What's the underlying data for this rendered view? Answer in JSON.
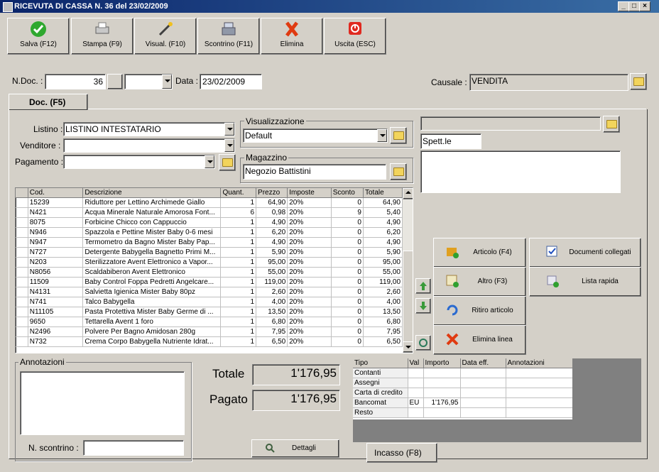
{
  "window": {
    "title": "RICEVUTA DI CASSA N. 36  del 23/02/2009"
  },
  "toolbar": [
    {
      "label": "Salva (F12)",
      "icon": "check-icon"
    },
    {
      "label": "Stampa (F9)",
      "icon": "printer-icon"
    },
    {
      "label": "Visual. (F10)",
      "icon": "magic-wand-icon"
    },
    {
      "label": "Scontrino (F11)",
      "icon": "cash-register-icon"
    },
    {
      "label": "Elimina",
      "icon": "delete-x-icon"
    },
    {
      "label": "Uscita (ESC)",
      "icon": "power-icon"
    }
  ],
  "header": {
    "ndoc_label": "N.Doc. :",
    "ndoc_value": "36",
    "series_value": "",
    "data_label": "Data :",
    "data_value": "23/02/2009",
    "causale_label": "Causale :",
    "causale_value": "VENDITA"
  },
  "tab": {
    "label": "Doc. (F5)"
  },
  "form": {
    "listino_label": "Listino :",
    "listino_value": "LISTINO INTESTATARIO",
    "venditore_label": "Venditore :",
    "venditore_value": "",
    "pagamento_label": "Pagamento :",
    "pagamento_value": "",
    "visualizzazione_title": "Visualizzazione",
    "visualizzazione_value": "Default",
    "magazzino_title": "Magazzino",
    "magazzino_value": "Negozio Battistini",
    "cliente_value": "",
    "spett_value": "Spett.le",
    "address_value": ""
  },
  "grid": {
    "columns": [
      "Cod.",
      "Descrizione",
      "Quant.",
      "Prezzo",
      "Imposte",
      "Sconto",
      "Totale"
    ],
    "rows": [
      [
        "15239",
        "Riduttore per Lettino Archimede Giallo",
        "1",
        "64,90",
        "20%",
        "0",
        "64,90"
      ],
      [
        "N421",
        "Acqua Minerale Naturale Amorosa Font...",
        "6",
        "0,98",
        "20%",
        "9",
        "5,40"
      ],
      [
        "8075",
        "Forbicine Chicco con Cappuccio",
        "1",
        "4,90",
        "20%",
        "0",
        "4,90"
      ],
      [
        "N946",
        "Spazzola e Pettine Mister Baby 0-6 mesi",
        "1",
        "6,20",
        "20%",
        "0",
        "6,20"
      ],
      [
        "N947",
        "Termometro da Bagno Mister Baby Pap...",
        "1",
        "4,90",
        "20%",
        "0",
        "4,90"
      ],
      [
        "N727",
        "Detergente Babygella Bagnetto Primi M...",
        "1",
        "5,90",
        "20%",
        "0",
        "5,90"
      ],
      [
        "N203",
        "Sterilizzatore Avent Elettronico a Vapor...",
        "1",
        "95,00",
        "20%",
        "0",
        "95,00"
      ],
      [
        "N8056",
        "Scaldabiberon Avent Elettronico",
        "1",
        "55,00",
        "20%",
        "0",
        "55,00"
      ],
      [
        "11509",
        "Baby Control Foppa Pedretti Angelcare...",
        "1",
        "119,00",
        "20%",
        "0",
        "119,00"
      ],
      [
        "N4131",
        "Salvietta Igienica Mister Baby 80pz",
        "1",
        "2,60",
        "20%",
        "0",
        "2,60"
      ],
      [
        "N741",
        "Talco Babygella",
        "1",
        "4,00",
        "20%",
        "0",
        "4,00"
      ],
      [
        "N11105",
        "Pasta Protettiva Mister Baby Germe di ...",
        "1",
        "13,50",
        "20%",
        "0",
        "13,50"
      ],
      [
        "9650",
        "Tettarella Avent 1 foro",
        "1",
        "6,80",
        "20%",
        "0",
        "6,80"
      ],
      [
        "N2496",
        "Polvere Per Bagno Amidosan 280g",
        "1",
        "7,95",
        "20%",
        "0",
        "7,95"
      ],
      [
        "N732",
        "Crema Corpo Babygella Nutriente Idrat...",
        "1",
        "6,50",
        "20%",
        "0",
        "6,50"
      ]
    ]
  },
  "actions": {
    "articolo": "Articolo (F4)",
    "altro": "Altro (F3)",
    "ritiro": "Ritiro articolo",
    "elimina_linea": "Elimina linea",
    "documenti": "Documenti collegati",
    "lista": "Lista rapida"
  },
  "annotazioni": {
    "title": "Annotazioni",
    "scontrino_label": "N. scontrino :",
    "scontrino_value": ""
  },
  "totals": {
    "totale_label": "Totale",
    "totale_value": "1'176,95",
    "pagato_label": "Pagato",
    "pagato_value": "1'176,95",
    "dettagli": "Dettagli"
  },
  "payments": {
    "columns": [
      "Tipo",
      "Val",
      "Importo",
      "Data eff.",
      "Annotazioni"
    ],
    "rows": [
      [
        "Contanti",
        "",
        "",
        "",
        ""
      ],
      [
        "Assegni",
        "",
        "",
        "",
        ""
      ],
      [
        "Carta di credito",
        "",
        "",
        "",
        ""
      ],
      [
        "Bancomat",
        "EU",
        "1'176,95",
        "",
        ""
      ],
      [
        "Resto",
        "",
        "",
        "",
        ""
      ]
    ]
  },
  "incasso": {
    "label": "Incasso (F8)"
  }
}
